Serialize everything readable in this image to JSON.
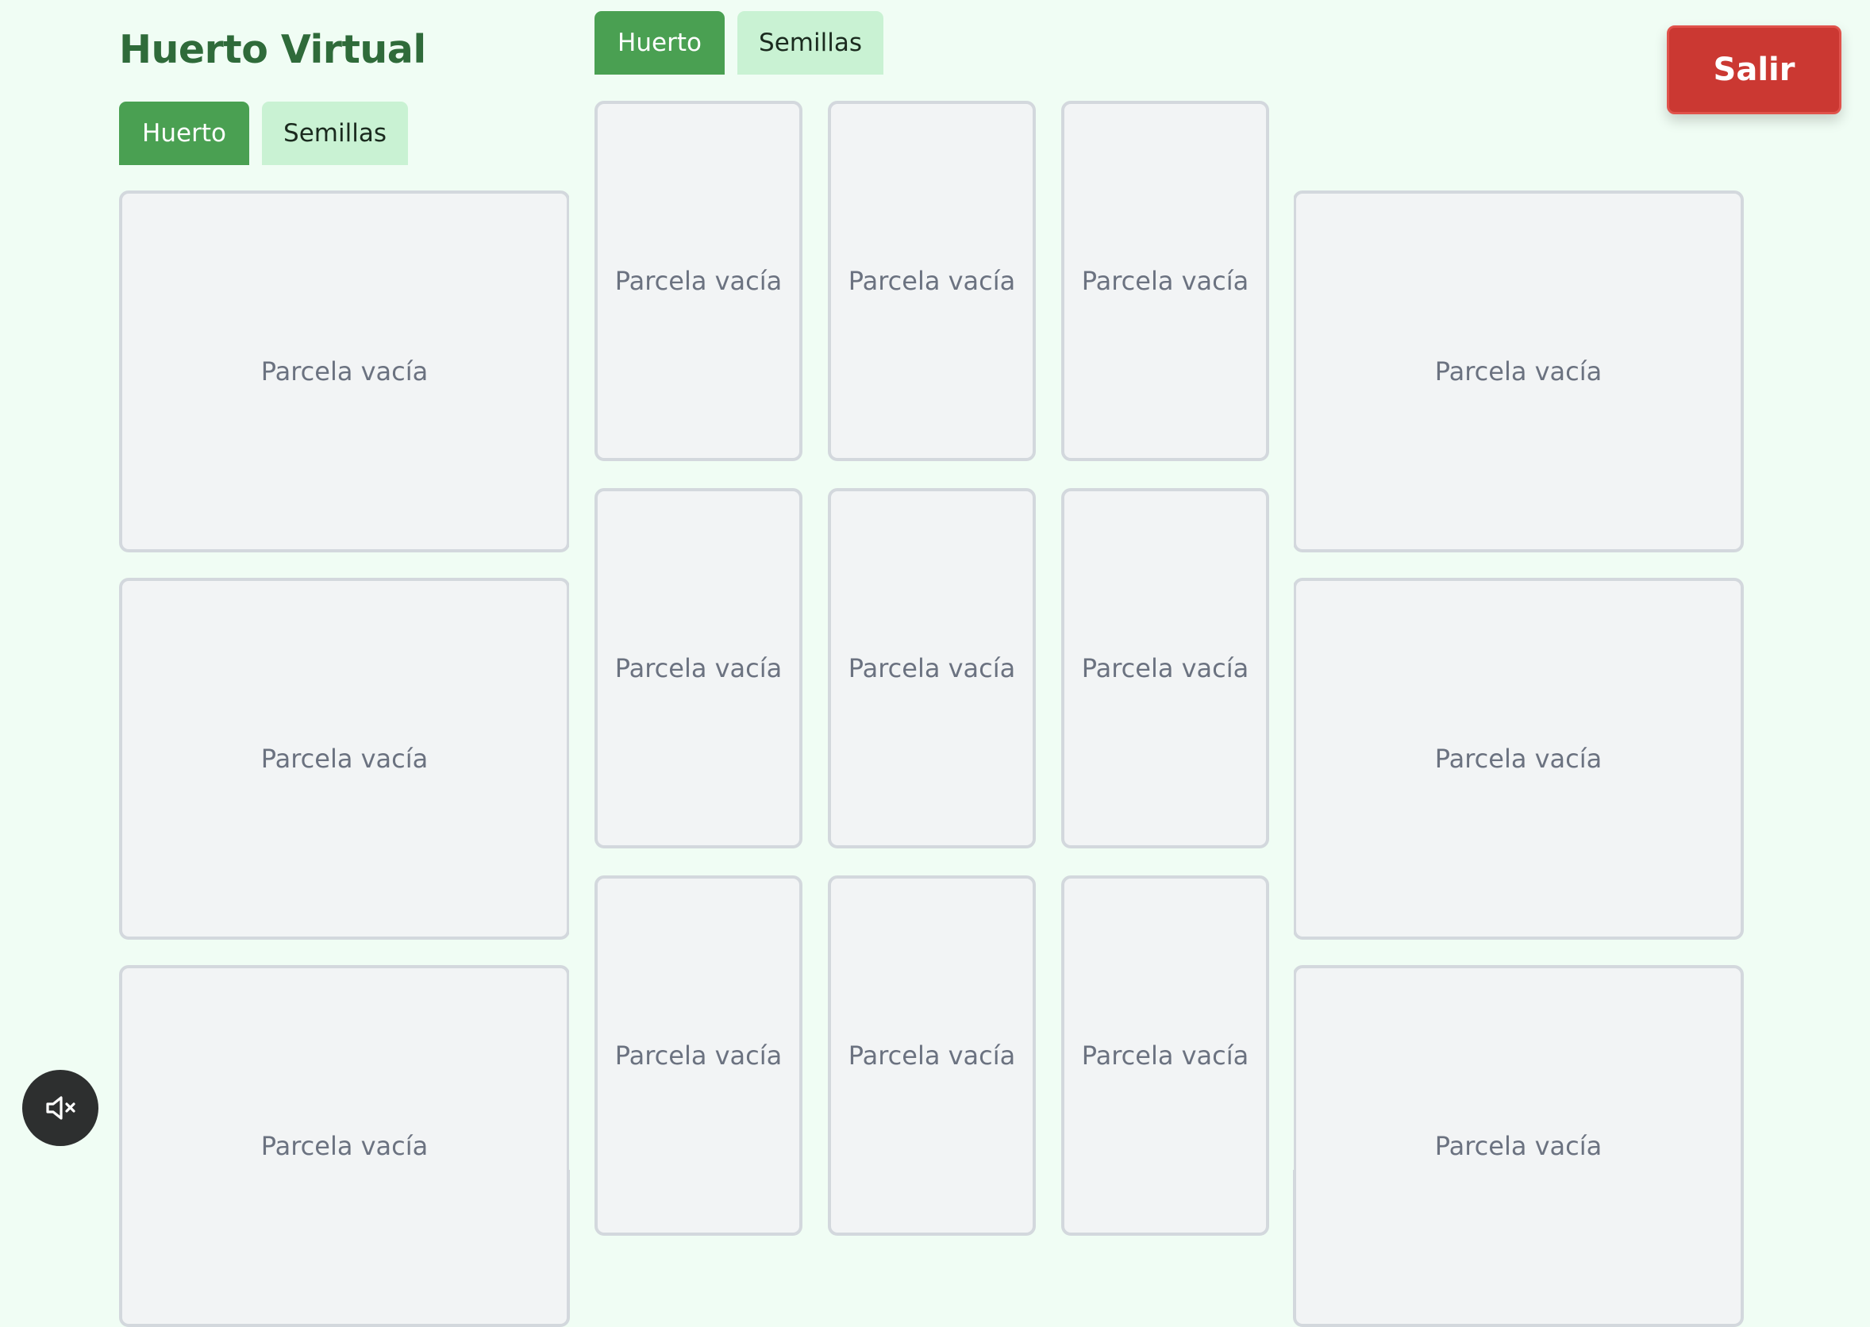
{
  "header": {
    "title": "Huerto Virtual"
  },
  "tabs": {
    "huerto_label": "Huerto",
    "semillas_label": "Semillas",
    "active": "Huerto"
  },
  "actions": {
    "exit_label": "Salir"
  },
  "plot": {
    "empty_label": "Parcela vacía"
  },
  "audio": {
    "icon": "volume-mute-icon",
    "muted": true
  },
  "colors": {
    "background": "#f0fdf4",
    "title": "#2f6b3a",
    "tab_active": "#4aa052",
    "tab_inactive": "#c9f2d3",
    "exit_button": "#cb3832",
    "plot_bg": "#f2f4f5",
    "plot_border": "#d3d8dd",
    "plot_text": "#6b7280",
    "mute_button": "#2d2f2f"
  }
}
